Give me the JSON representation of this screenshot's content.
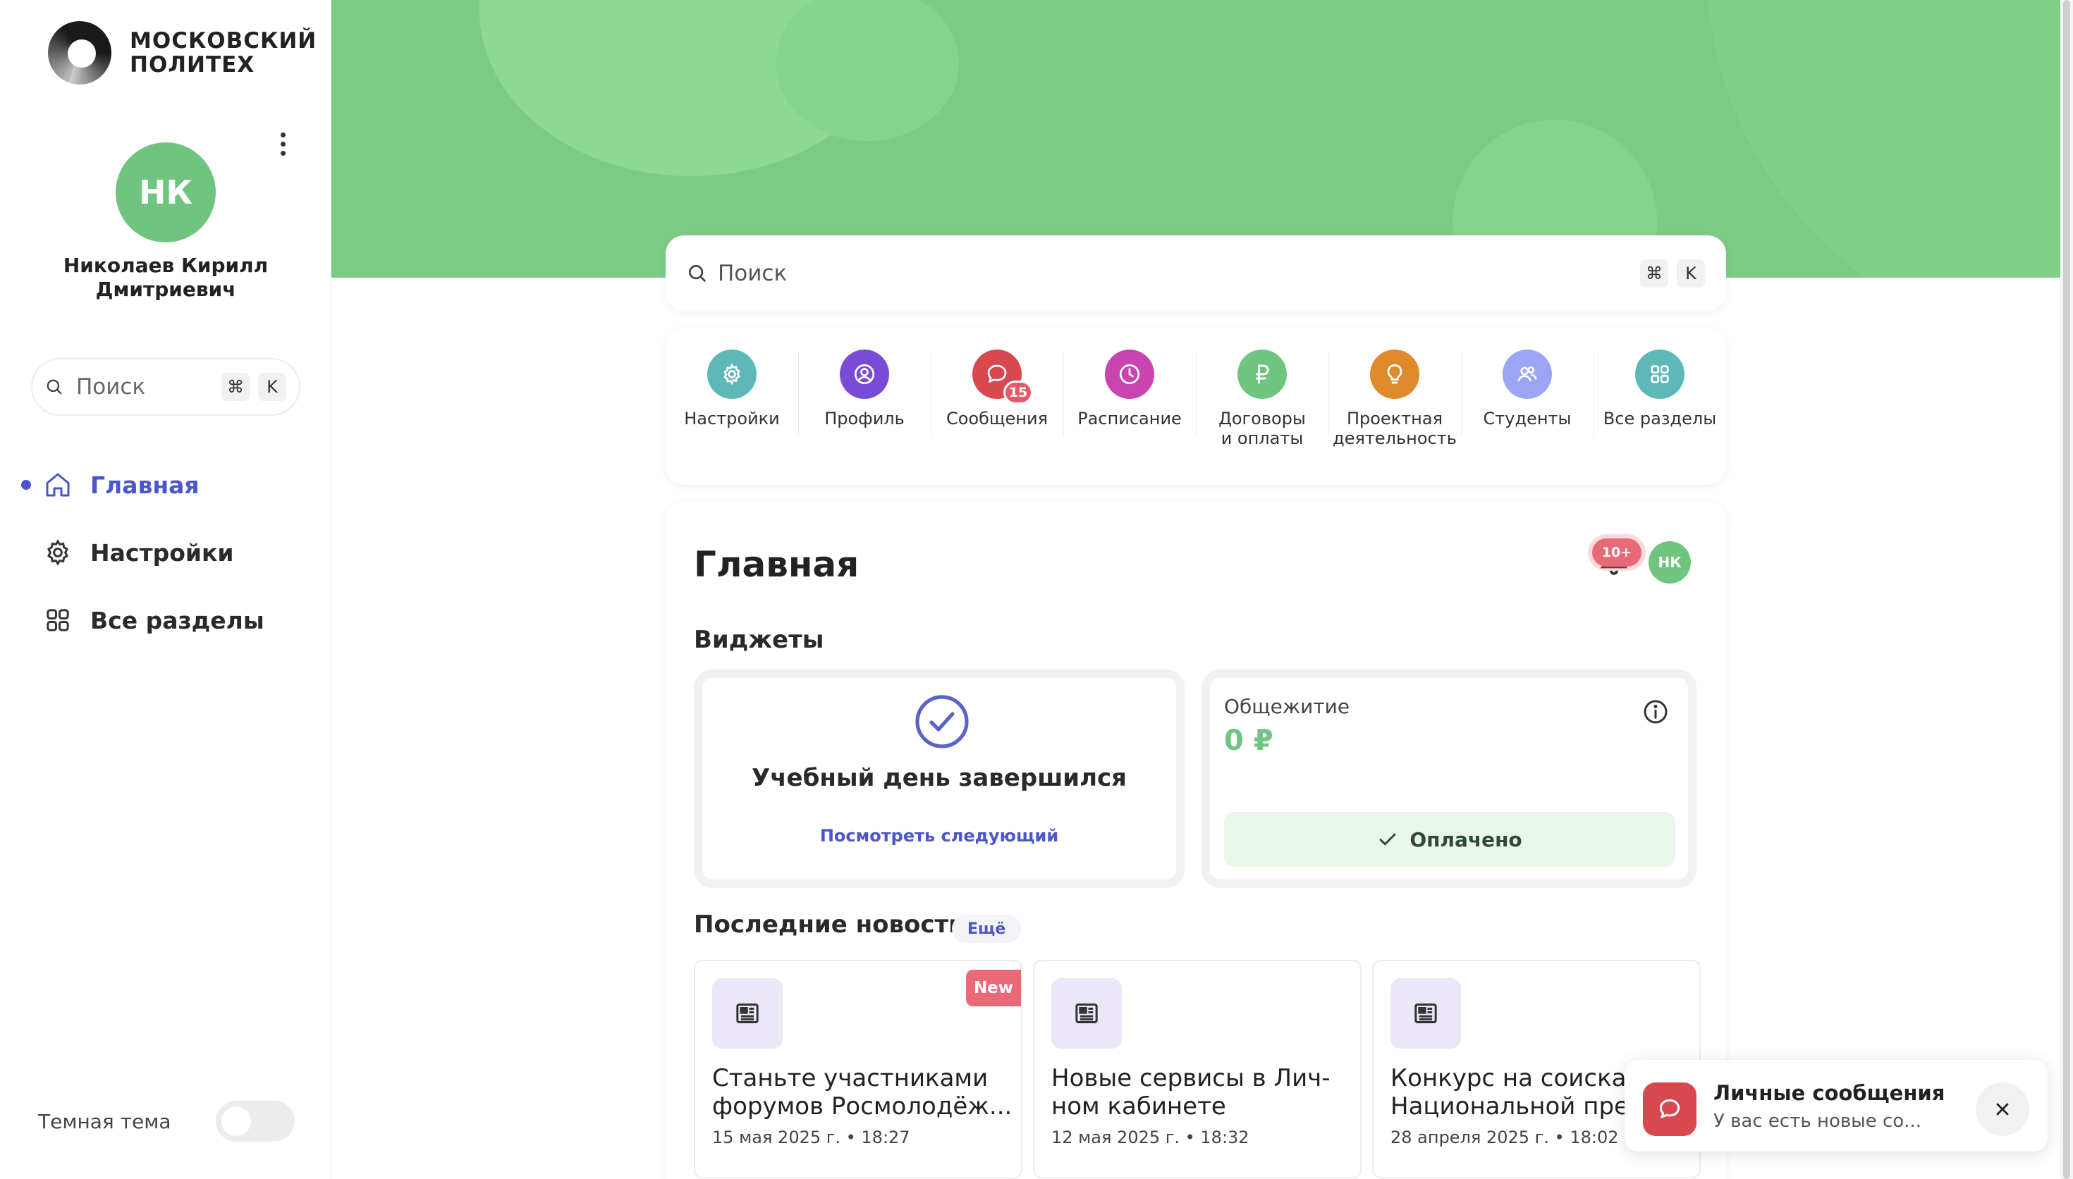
{
  "brand": {
    "logo_line1": "МОСКОВСКИЙ",
    "logo_line2": "ПОЛИТЕХ"
  },
  "user": {
    "initials": "НК",
    "name_line1": "Николаев Кирилл",
    "name_line2": "Дмитриевич",
    "avatar_color": "#6fc57f"
  },
  "sidebar": {
    "search_placeholder": "Поиск",
    "kbd_cmd": "⌘",
    "kbd_k": "K",
    "items": [
      {
        "label": "Главная",
        "icon": "home-icon",
        "active": true
      },
      {
        "label": "Настройки",
        "icon": "gear-icon",
        "active": false
      },
      {
        "label": "Все разделы",
        "icon": "grid-icon",
        "active": false
      }
    ],
    "theme_label": "Темная тема",
    "dark_theme_enabled": false
  },
  "search": {
    "placeholder": "Поиск",
    "kbd_cmd": "⌘",
    "kbd_k": "K"
  },
  "quick_links": [
    {
      "label": "Настройки",
      "icon": "gear-icon",
      "color": "#5fb8b8"
    },
    {
      "label": "Профиль",
      "icon": "user-circle-icon",
      "color": "#7a4bd6"
    },
    {
      "label": "Сообщения",
      "icon": "chat-icon",
      "color": "#d9474f",
      "badge": "15"
    },
    {
      "label": "Расписание",
      "icon": "clock-icon",
      "color": "#c944b0"
    },
    {
      "label": "Договоры",
      "label2": "и оплаты",
      "icon": "ruble-icon",
      "color": "#6fc57f"
    },
    {
      "label": "Проектная",
      "label2": "деятельность",
      "icon": "lightbulb-icon",
      "color": "#e08a2e"
    },
    {
      "label": "Студенты",
      "icon": "users-icon",
      "color": "#9aa6f5"
    },
    {
      "label": "Все разделы",
      "icon": "grid-icon",
      "color": "#5fb8b8"
    }
  ],
  "main": {
    "title": "Главная",
    "notifications_badge": "10+",
    "user_initials": "НК",
    "widgets_title": "Виджеты",
    "schedule_widget": {
      "text": "Учебный день завершился",
      "link": "Посмотреть следующий"
    },
    "dorm_widget": {
      "title": "Общежитие",
      "amount": "0 ₽",
      "status": "Оплачено"
    },
    "news_title": "Последние новости",
    "news_more": "Ещё",
    "news": [
      {
        "line1": "Станьте участниками",
        "line2": "форумов Росмолодёж...",
        "date": "15 мая 2025 г. • 18:27",
        "badge": "New"
      },
      {
        "line1": "Новые сервисы в Лич-",
        "line2": "ном кабинете",
        "date": "12 мая 2025 г. • 18:32"
      },
      {
        "line1": "Конкурс на соискан",
        "line2": "Национальной прем",
        "date": "28 апреля 2025 г. • 18:02"
      }
    ]
  },
  "toast": {
    "title": "Личные сообщения",
    "text": "У вас есть новые со...",
    "icon": "chat-icon"
  },
  "colors": {
    "accent": "#4a56c9",
    "banner": "#7ccb85",
    "alert": "#e86a77"
  }
}
